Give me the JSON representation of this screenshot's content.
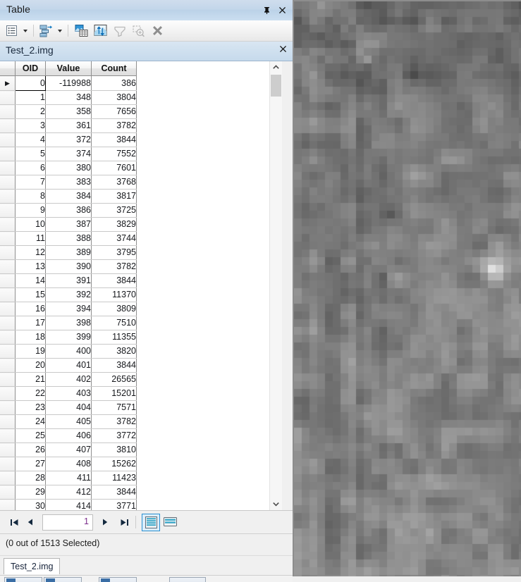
{
  "panel": {
    "title": "Table",
    "pin_icon": "pin-icon",
    "close_icon": "close-icon"
  },
  "toolbar": {
    "items": [
      {
        "name": "table-options-button",
        "icon": "table-options-icon",
        "enabled": true
      },
      {
        "name": "table-options-dropdown",
        "icon": "chevron-down-icon",
        "enabled": true
      },
      {
        "name": "related-tables-button",
        "icon": "related-tables-icon",
        "enabled": true
      },
      {
        "name": "related-tables-dropdown",
        "icon": "chevron-down-icon",
        "enabled": true
      },
      {
        "name": "select-by-attributes-button",
        "icon": "select-by-attributes-icon",
        "enabled": true
      },
      {
        "name": "switch-selection-button",
        "icon": "switch-selection-icon",
        "enabled": true
      },
      {
        "name": "zoom-to-selected-button",
        "icon": "zoom-to-selected-icon",
        "enabled": false
      },
      {
        "name": "clear-selection-button",
        "icon": "clear-selection-icon",
        "enabled": false
      },
      {
        "name": "delete-selection-button",
        "icon": "delete-x-icon",
        "enabled": true
      }
    ]
  },
  "layer_header": {
    "name": "Test_2.img",
    "close_icon": "close-icon"
  },
  "grid": {
    "columns": [
      "",
      "OID",
      "Value",
      "Count"
    ],
    "rows": [
      {
        "cur": "▶",
        "oid": "0",
        "value": "-119988",
        "count": "386"
      },
      {
        "cur": "",
        "oid": "1",
        "value": "348",
        "count": "3804"
      },
      {
        "cur": "",
        "oid": "2",
        "value": "358",
        "count": "7656"
      },
      {
        "cur": "",
        "oid": "3",
        "value": "361",
        "count": "3782"
      },
      {
        "cur": "",
        "oid": "4",
        "value": "372",
        "count": "3844"
      },
      {
        "cur": "",
        "oid": "5",
        "value": "374",
        "count": "7552"
      },
      {
        "cur": "",
        "oid": "6",
        "value": "380",
        "count": "7601"
      },
      {
        "cur": "",
        "oid": "7",
        "value": "383",
        "count": "3768"
      },
      {
        "cur": "",
        "oid": "8",
        "value": "384",
        "count": "3817"
      },
      {
        "cur": "",
        "oid": "9",
        "value": "386",
        "count": "3725"
      },
      {
        "cur": "",
        "oid": "10",
        "value": "387",
        "count": "3829"
      },
      {
        "cur": "",
        "oid": "11",
        "value": "388",
        "count": "3744"
      },
      {
        "cur": "",
        "oid": "12",
        "value": "389",
        "count": "3795"
      },
      {
        "cur": "",
        "oid": "13",
        "value": "390",
        "count": "3782"
      },
      {
        "cur": "",
        "oid": "14",
        "value": "391",
        "count": "3844"
      },
      {
        "cur": "",
        "oid": "15",
        "value": "392",
        "count": "11370"
      },
      {
        "cur": "",
        "oid": "16",
        "value": "394",
        "count": "3809"
      },
      {
        "cur": "",
        "oid": "17",
        "value": "398",
        "count": "7510"
      },
      {
        "cur": "",
        "oid": "18",
        "value": "399",
        "count": "11355"
      },
      {
        "cur": "",
        "oid": "19",
        "value": "400",
        "count": "3820"
      },
      {
        "cur": "",
        "oid": "20",
        "value": "401",
        "count": "3844"
      },
      {
        "cur": "",
        "oid": "21",
        "value": "402",
        "count": "26565"
      },
      {
        "cur": "",
        "oid": "22",
        "value": "403",
        "count": "15201"
      },
      {
        "cur": "",
        "oid": "23",
        "value": "404",
        "count": "7571"
      },
      {
        "cur": "",
        "oid": "24",
        "value": "405",
        "count": "3782"
      },
      {
        "cur": "",
        "oid": "25",
        "value": "406",
        "count": "3772"
      },
      {
        "cur": "",
        "oid": "26",
        "value": "407",
        "count": "3810"
      },
      {
        "cur": "",
        "oid": "27",
        "value": "408",
        "count": "15262"
      },
      {
        "cur": "",
        "oid": "28",
        "value": "411",
        "count": "11423"
      },
      {
        "cur": "",
        "oid": "29",
        "value": "412",
        "count": "3844"
      },
      {
        "cur": "",
        "oid": "30",
        "value": "414",
        "count": "3771"
      }
    ]
  },
  "scrollbar": {
    "up_icon": "chevron-up-icon",
    "down_icon": "chevron-down-icon"
  },
  "navigation": {
    "first_icon": "◀❘",
    "prev_icon": "◀",
    "next_icon": "▶",
    "last_icon": "❘▶",
    "page": "1",
    "view_table_icon": "table-view-icon",
    "view_form_icon": "form-view-icon"
  },
  "status": {
    "selection_text": "(0 out of 1513 Selected)"
  },
  "tabs": [
    {
      "label": "Test_2.img",
      "active": true
    }
  ],
  "colors": {
    "title_accent": "#c3d6ea",
    "selected_view": "#2a8fd0",
    "page_number": "#7b2d8b",
    "icon_blue": "#2f94d6"
  }
}
